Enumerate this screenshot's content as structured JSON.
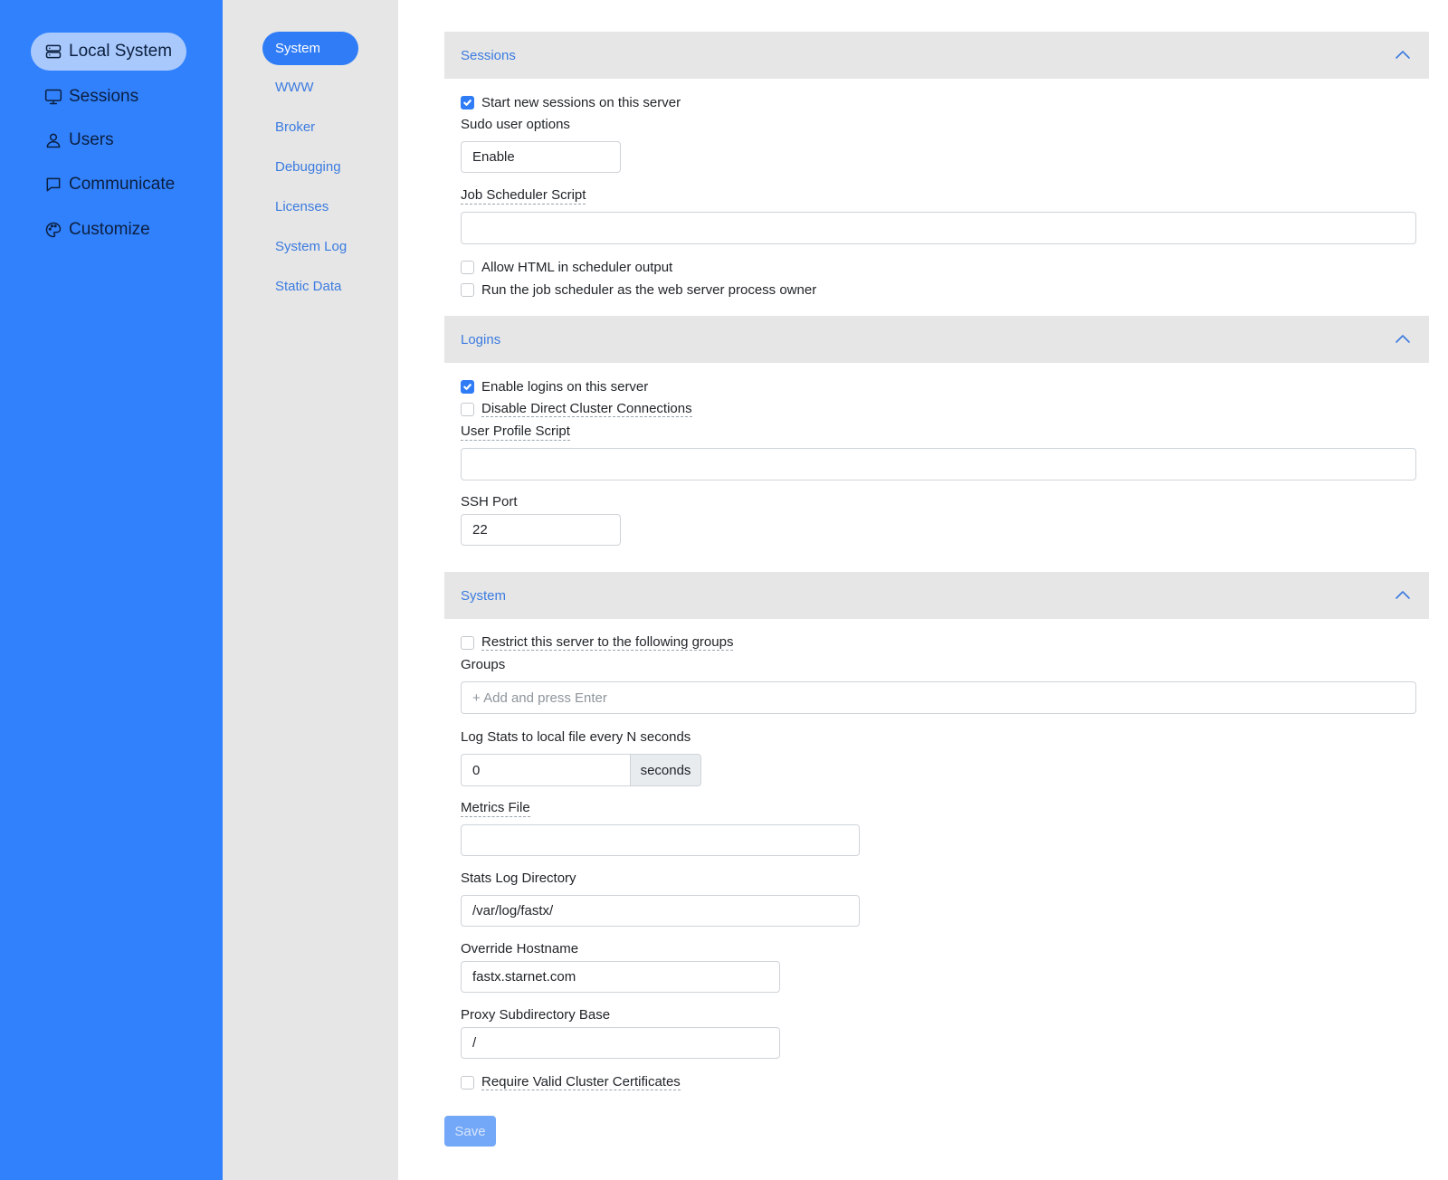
{
  "nav": {
    "items": [
      {
        "label": "Local System",
        "icon": "server-icon",
        "active": true
      },
      {
        "label": "Sessions",
        "icon": "monitor-icon",
        "active": false
      },
      {
        "label": "Users",
        "icon": "user-icon",
        "active": false
      },
      {
        "label": "Communicate",
        "icon": "message-icon",
        "active": false
      },
      {
        "label": "Customize",
        "icon": "palette-icon",
        "active": false
      }
    ]
  },
  "subnav": {
    "items": [
      {
        "label": "System",
        "active": true
      },
      {
        "label": "WWW",
        "active": false
      },
      {
        "label": "Broker",
        "active": false
      },
      {
        "label": "Debugging",
        "active": false
      },
      {
        "label": "Licenses",
        "active": false
      },
      {
        "label": "System Log",
        "active": false
      },
      {
        "label": "Static Data",
        "active": false
      }
    ]
  },
  "sessions": {
    "title": "Sessions",
    "start_new_sessions": {
      "label": "Start new sessions on this server",
      "checked": true
    },
    "sudo_label": "Sudo user options",
    "sudo_value": "Enable",
    "job_scheduler_label": "Job Scheduler Script",
    "job_scheduler_value": "",
    "allow_html": {
      "label": "Allow HTML in scheduler output",
      "checked": false
    },
    "run_as_owner": {
      "label": "Run the job scheduler as the web server process owner",
      "checked": false
    }
  },
  "logins": {
    "title": "Logins",
    "enable_logins": {
      "label": "Enable logins on this server",
      "checked": true
    },
    "disable_direct": {
      "label": "Disable Direct Cluster Connections",
      "checked": false
    },
    "user_profile_label": "User Profile Script",
    "user_profile_value": "",
    "ssh_port_label": "SSH Port",
    "ssh_port_value": "22"
  },
  "system": {
    "title": "System",
    "restrict_groups": {
      "label": "Restrict this server to the following groups",
      "checked": false
    },
    "groups_label": "Groups",
    "groups_placeholder": "+ Add and press Enter",
    "log_stats_label": "Log Stats to local file every N seconds",
    "log_stats_value": "0",
    "log_stats_unit": "seconds",
    "metrics_label": "Metrics File",
    "metrics_value": "",
    "stats_dir_label": "Stats Log Directory",
    "stats_dir_value": "/var/log/fastx/",
    "override_host_label": "Override Hostname",
    "override_host_value": "fastx.starnet.com",
    "proxy_base_label": "Proxy Subdirectory Base",
    "proxy_base_value": "/",
    "require_certs": {
      "label": "Require Valid Cluster Certificates",
      "checked": false
    }
  },
  "save_label": "Save",
  "colors": {
    "nav_bg": "#3181fd",
    "accent": "#2f7cf6",
    "subnav_bg": "#e6e6e6",
    "link": "#3b7be0"
  }
}
